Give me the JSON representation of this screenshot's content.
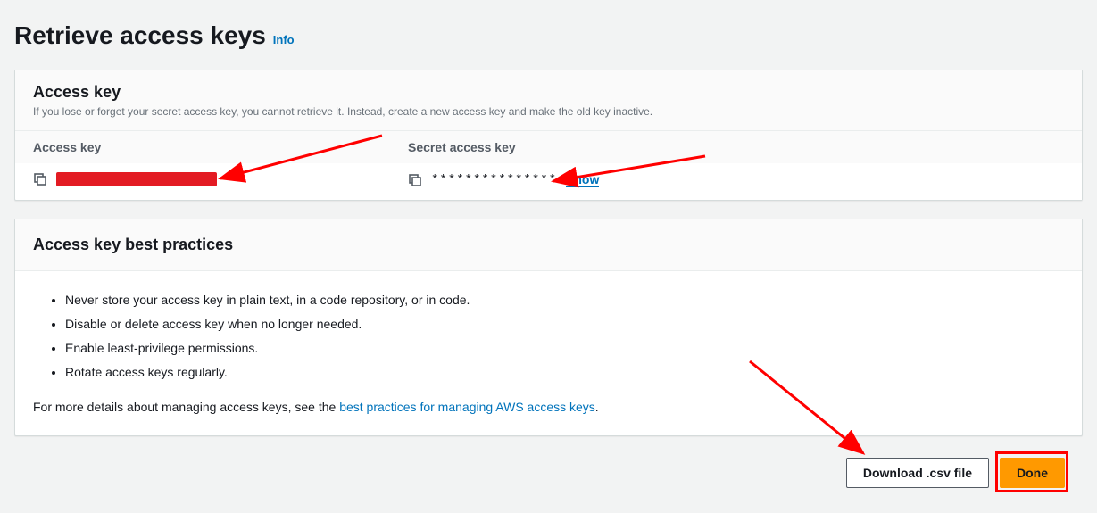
{
  "page": {
    "title": "Retrieve access keys",
    "info_label": "Info"
  },
  "access_key_panel": {
    "title": "Access key",
    "description": "If you lose or forget your secret access key, you cannot retrieve it. Instead, create a new access key and make the old key inactive.",
    "columns": {
      "access_key": "Access key",
      "secret_access_key": "Secret access key"
    },
    "access_key_value_redacted": true,
    "secret_masked": "***************",
    "show_label": "Show"
  },
  "best_practices_panel": {
    "title": "Access key best practices",
    "items": [
      "Never store your access key in plain text, in a code repository, or in code.",
      "Disable or delete access key when no longer needed.",
      "Enable least-privilege permissions.",
      "Rotate access keys regularly."
    ],
    "more_details_prefix": "For more details about managing access keys, see the ",
    "more_details_link": "best practices for managing AWS access keys",
    "more_details_suffix": "."
  },
  "buttons": {
    "download_csv": "Download .csv file",
    "done": "Done"
  },
  "icons": {
    "copy": "copy-icon"
  }
}
